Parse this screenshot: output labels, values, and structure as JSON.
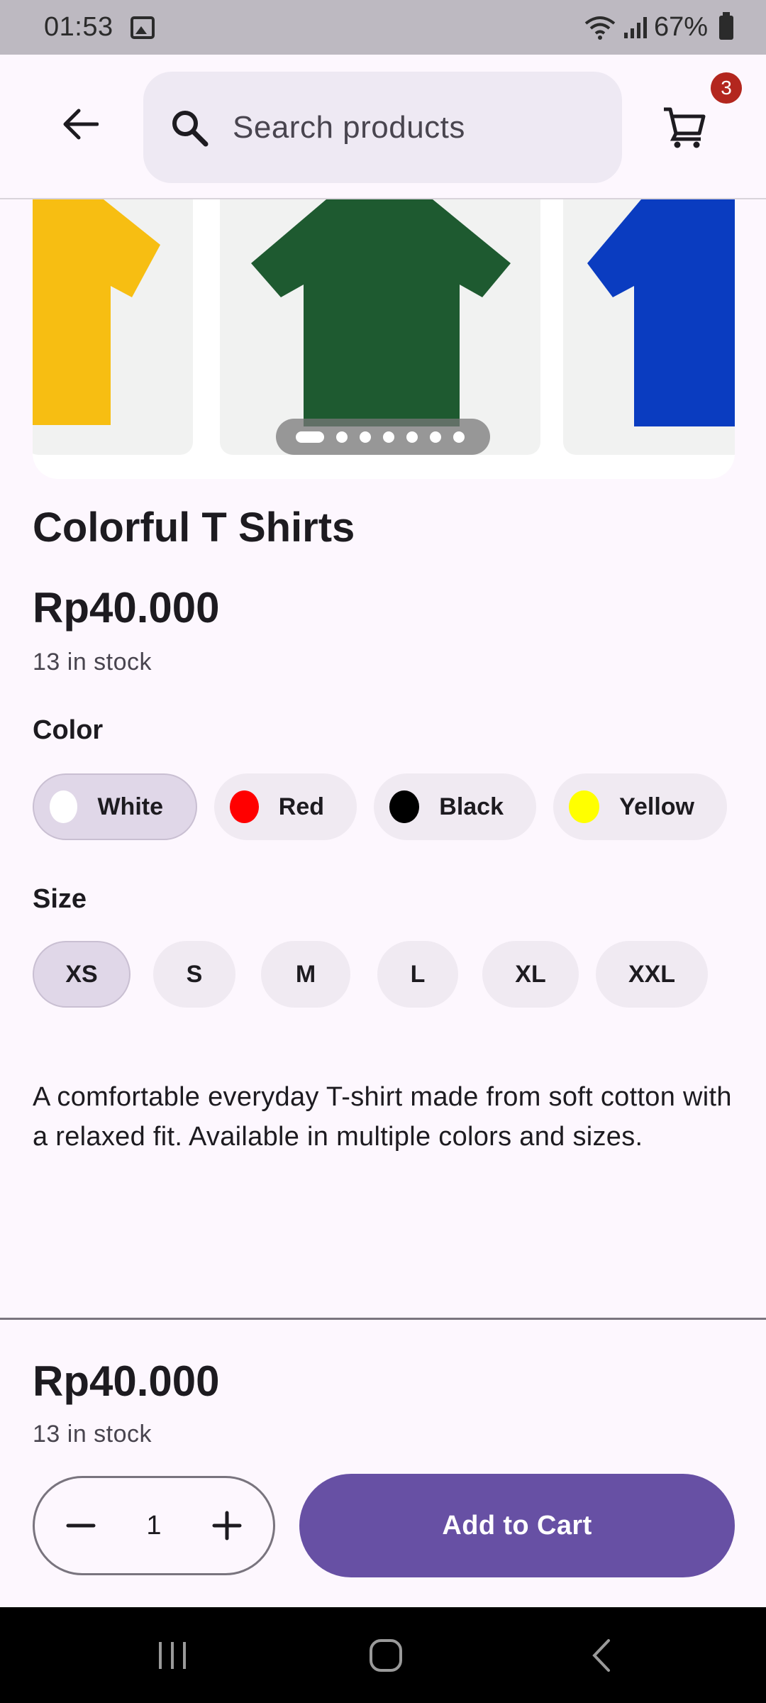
{
  "status_bar": {
    "time": "01:53",
    "battery": "67%"
  },
  "app_bar": {
    "search_placeholder": "Search products",
    "cart_count": "3"
  },
  "carousel": {
    "slide_colors": [
      "#F7BE12",
      "#1E5A30",
      "#0A3CC0"
    ],
    "page_count": 7,
    "active_index": 0
  },
  "product": {
    "title": "Colorful T Shirts",
    "price": "Rp40.000",
    "stock": "13 in stock",
    "color_label": "Color",
    "colors": [
      {
        "name": "White",
        "swatch": "#FFFFFF",
        "selected": true
      },
      {
        "name": "Red",
        "swatch": "#FF0000",
        "selected": false
      },
      {
        "name": "Black",
        "swatch": "#000000",
        "selected": false
      },
      {
        "name": "Yellow",
        "swatch": "#FFFF00",
        "selected": false
      }
    ],
    "size_label": "Size",
    "sizes": [
      {
        "name": "XS",
        "selected": true
      },
      {
        "name": "S",
        "selected": false
      },
      {
        "name": "M",
        "selected": false
      },
      {
        "name": "L",
        "selected": false
      },
      {
        "name": "XL",
        "selected": false
      },
      {
        "name": "XXL",
        "selected": false
      }
    ],
    "description": "A comfortable everyday T-shirt made from soft cotton with a relaxed fit. Available in multiple colors and sizes."
  },
  "bottom": {
    "price": "Rp40.000",
    "stock": "13 in stock",
    "quantity": "1",
    "add_to_cart": "Add to Cart"
  },
  "theme": {
    "primary": "#6750A4",
    "badge": "#B3261E"
  }
}
